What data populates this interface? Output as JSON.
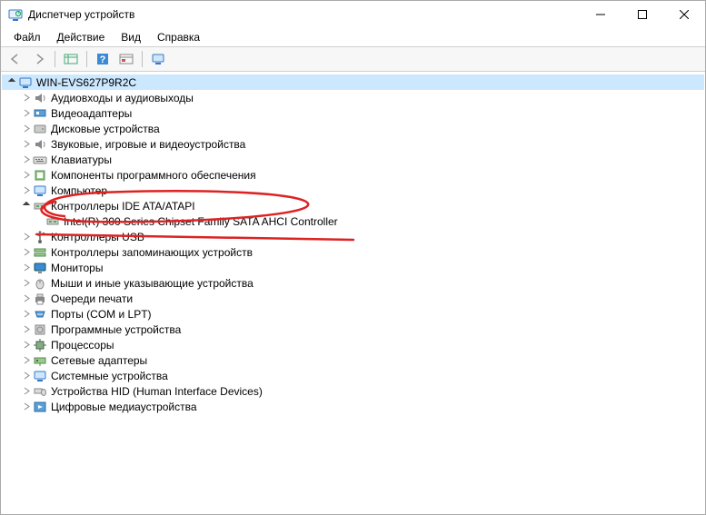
{
  "window": {
    "title": "Диспетчер устройств"
  },
  "menu": {
    "file": "Файл",
    "action": "Действие",
    "view": "Вид",
    "help": "Справка"
  },
  "tree": {
    "root": "WIN-EVS627P9R2C",
    "nodes": {
      "audio": "Аудиовходы и аудиовыходы",
      "video": "Видеоадаптеры",
      "disk": "Дисковые устройства",
      "sound": "Звуковые, игровые и видеоустройства",
      "keyboard": "Клавиатуры",
      "software": "Компоненты программного обеспечения",
      "computer": "Компьютер",
      "ide": "Контроллеры IDE ATA/ATAPI",
      "ide_child": "Intel(R) 300 Series Chipset Family SATA AHCI Controller",
      "usb": "Контроллеры USB",
      "storage": "Контроллеры запоминающих устройств",
      "monitors": "Мониторы",
      "mice": "Мыши и иные указывающие устройства",
      "printq": "Очереди печати",
      "ports": "Порты (COM и LPT)",
      "softdev": "Программные устройства",
      "cpu": "Процессоры",
      "net": "Сетевые адаптеры",
      "system": "Системные устройства",
      "hid": "Устройства HID (Human Interface Devices)",
      "media": "Цифровые медиаустройства"
    }
  }
}
